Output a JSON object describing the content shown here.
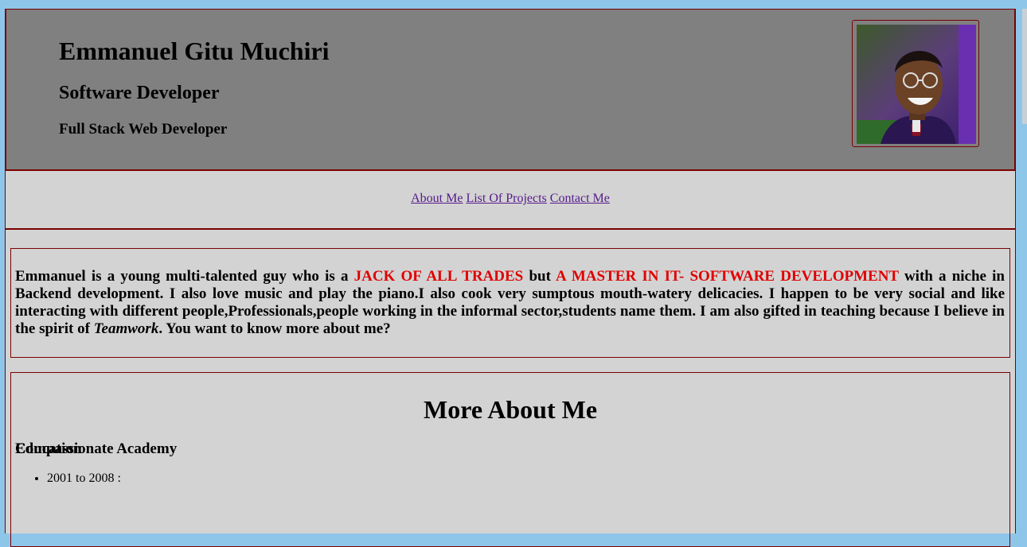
{
  "header": {
    "name": "Emmanuel Gitu Muchiri",
    "role": "Software Developer",
    "subrole": "Full Stack Web Developer"
  },
  "nav": {
    "about": "About Me",
    "projects": "List Of Projects",
    "contact": "Contact Me"
  },
  "intro": {
    "part1": "Emmanuel is a young multi-talented guy who is a ",
    "highlight1": "JACK OF ALL TRADES",
    "part2": " but ",
    "highlight2": "A MASTER IN IT- SOFTWARE DEVELOPMENT",
    "part3": " with a niche in Backend development. I also love music and play the piano.I also cook very sumptous mouth-watery delicacies. I happen to be very social and like interacting with different people,Professionals,people working in the informal sector,students name them. I am also gifted in teaching because I believe in the spirit of ",
    "emphasis": "Teamwork",
    "part4": ". You want to know more about me?"
  },
  "more": {
    "title": "More About Me",
    "education_heading": "Education",
    "education_items": [
      {
        "years": "2001 to 2008 :",
        "school": "Compassionate Academy"
      }
    ]
  },
  "colors": {
    "page_bg": "#d3d3d3",
    "header_bg": "#808080",
    "border": "#7a0000",
    "highlight": "#e00000",
    "link": "#551a8b"
  }
}
